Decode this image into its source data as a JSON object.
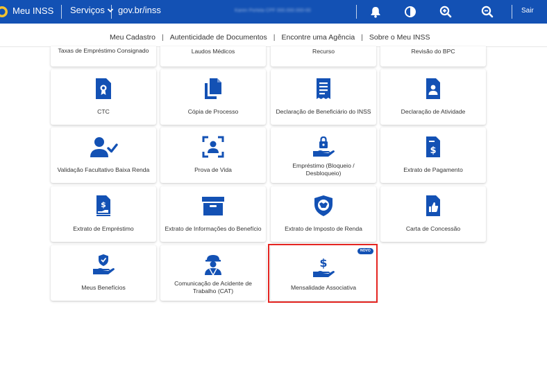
{
  "header": {
    "app_title": "Meu INSS",
    "services_label": "Serviços",
    "gov_link": "gov.br/inss",
    "user_info": "Karen Portela  CPF 000.000.000-00",
    "logout_label": "Sair",
    "icons": [
      "bell-icon",
      "contrast-icon",
      "zoom-in-icon",
      "zoom-out-icon"
    ]
  },
  "subnav": {
    "items": [
      "Meu Cadastro",
      "Autenticidade de Documentos",
      "Encontre uma Agência",
      "Sobre o Meu INSS"
    ],
    "separator": "|"
  },
  "services": {
    "partial_row": [
      "Taxas de Empréstimo Consignado",
      "Laudos Médicos",
      "Recurso",
      "Revisão do BPC"
    ],
    "cards": [
      {
        "label": "CTC",
        "icon": "certificate-document-icon"
      },
      {
        "label": "Cópia de Processo",
        "icon": "copy-files-icon"
      },
      {
        "label": "Declaração de Beneficiário do INSS",
        "icon": "receipt-icon"
      },
      {
        "label": "Declaração de Atividade",
        "icon": "person-document-icon"
      },
      {
        "label": "Validação Facultativo Baixa Renda",
        "icon": "user-check-icon"
      },
      {
        "label": "Prova de Vida",
        "icon": "face-scan-icon"
      },
      {
        "label": "Empréstimo (Bloqueio / Desbloqueio)",
        "icon": "hand-lock-icon"
      },
      {
        "label": "Extrato de Pagamento",
        "icon": "dollar-document-icon"
      },
      {
        "label": "Extrato de Empréstimo",
        "icon": "loan-document-icon"
      },
      {
        "label": "Extrato de Informações do Benefício",
        "icon": "archive-box-icon"
      },
      {
        "label": "Extrato de Imposto de Renda",
        "icon": "tax-shield-icon"
      },
      {
        "label": "Carta de Concessão",
        "icon": "thumbs-up-document-icon"
      },
      {
        "label": "Meus Benefícios",
        "icon": "hand-shield-icon"
      },
      {
        "label": "Comunicação de Acidente de Trabalho (CAT)",
        "icon": "worker-helmet-icon"
      },
      {
        "label": "Mensalidade Associativa",
        "icon": "hand-dollar-icon",
        "badge": "NOVO"
      }
    ]
  },
  "colors": {
    "primary": "#1351b4",
    "highlight": "#e52521",
    "card_background": "#ffffff",
    "text": "#333333"
  }
}
